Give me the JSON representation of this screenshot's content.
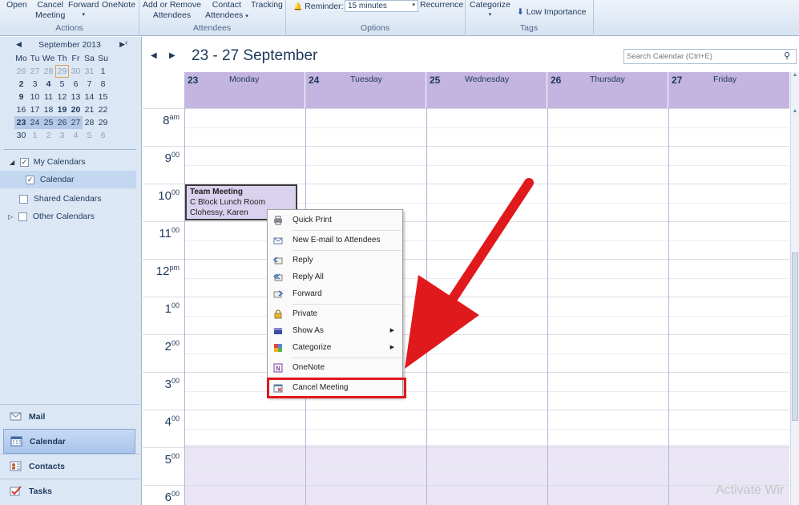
{
  "ribbon": {
    "open": "Open",
    "cancel_meeting": [
      "Cancel",
      "Meeting"
    ],
    "forward": "Forward",
    "onenote": "OneNote",
    "add_remove": [
      "Add or Remove",
      "Attendees"
    ],
    "contact_attendees": [
      "Contact",
      "Attendees"
    ],
    "tracking": "Tracking",
    "reminder_label": "Reminder:",
    "reminder_value": "15 minutes",
    "recurrence": "Recurrence",
    "categorize": "Categorize",
    "low_importance": "Low Importance",
    "groups": {
      "actions": "Actions",
      "attendees": "Attendees",
      "options": "Options",
      "tags": "Tags"
    }
  },
  "mini_calendar": {
    "month": "September 2013",
    "dow": [
      "Mo",
      "Tu",
      "We",
      "Th",
      "Fr",
      "Sa",
      "Su"
    ],
    "weeks": [
      [
        "26",
        "27",
        "28",
        "29",
        "30",
        "31",
        "1"
      ],
      [
        "2",
        "3",
        "4",
        "5",
        "6",
        "7",
        "8"
      ],
      [
        "9",
        "10",
        "11",
        "12",
        "13",
        "14",
        "15"
      ],
      [
        "16",
        "17",
        "18",
        "19",
        "20",
        "21",
        "22"
      ],
      [
        "23",
        "24",
        "25",
        "26",
        "27",
        "28",
        "29"
      ],
      [
        "30",
        "1",
        "2",
        "3",
        "4",
        "5",
        "6"
      ]
    ]
  },
  "calendar_tree": {
    "my_calendars": "My Calendars",
    "calendar": "Calendar",
    "shared": "Shared Calendars",
    "other": "Other Calendars"
  },
  "nav": {
    "mail": "Mail",
    "calendar": "Calendar",
    "contacts": "Contacts",
    "tasks": "Tasks"
  },
  "view": {
    "date_range": "23 - 27 September",
    "search_placeholder": "Search Calendar (Ctrl+E)",
    "days": [
      {
        "num": "23",
        "name": "Monday"
      },
      {
        "num": "24",
        "name": "Tuesday"
      },
      {
        "num": "25",
        "name": "Wednesday"
      },
      {
        "num": "26",
        "name": "Thursday"
      },
      {
        "num": "27",
        "name": "Friday"
      }
    ],
    "hours": [
      {
        "h": "8",
        "s": "am"
      },
      {
        "h": "9",
        "s": "00"
      },
      {
        "h": "10",
        "s": "00"
      },
      {
        "h": "11",
        "s": "00"
      },
      {
        "h": "12",
        "s": "pm"
      },
      {
        "h": "1",
        "s": "00"
      },
      {
        "h": "2",
        "s": "00"
      },
      {
        "h": "3",
        "s": "00"
      },
      {
        "h": "4",
        "s": "00"
      },
      {
        "h": "5",
        "s": "00"
      },
      {
        "h": "6",
        "s": "00"
      }
    ]
  },
  "meeting": {
    "title": "Team Meeting",
    "location": "C Block Lunch Room",
    "organizer": "Clohessy, Karen"
  },
  "context_menu": {
    "items": [
      "Quick Print",
      "New E-mail to Attendees",
      "Reply",
      "Reply All",
      "Forward",
      "Private",
      "Show As",
      "Categorize",
      "OneNote",
      "Cancel Meeting"
    ]
  },
  "watermark": "Activate Wir",
  "colors": {
    "annotation": "#e0191c",
    "day_header": "#c3b5e0",
    "appointment": "#d9d1ee"
  }
}
